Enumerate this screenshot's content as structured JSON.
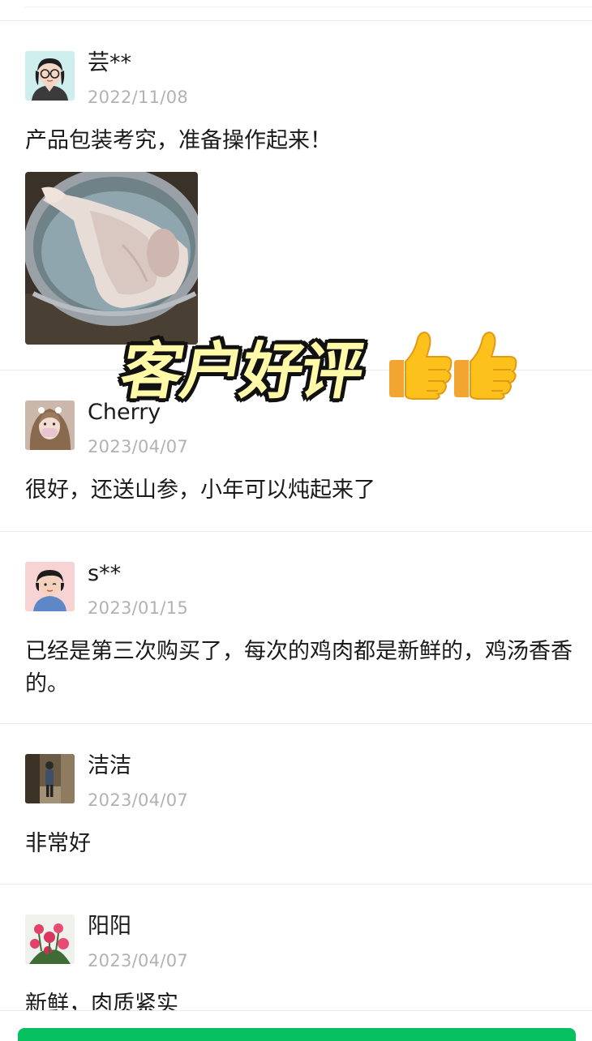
{
  "overlay": {
    "title": "客户好评"
  },
  "reviews": [
    {
      "name": "芸**",
      "date": "2022/11/08",
      "text": "产品包装考究，准备操作起来！",
      "avatar": "woman-glasses-avatar"
    },
    {
      "name": "Cherry",
      "date": "2023/04/07",
      "text": "很好，还送山参，小年可以炖起来了",
      "avatar": "girl-photo-avatar"
    },
    {
      "name": "s**",
      "date": "2023/01/15",
      "text": "已经是第三次购买了，每次的鸡肉都是新鲜的，鸡汤香香的。",
      "avatar": "cartoon-woman-avatar"
    },
    {
      "name": "洁洁",
      "date": "2023/04/07",
      "text": "非常好",
      "avatar": "street-photo-avatar"
    },
    {
      "name": "阳阳",
      "date": "2023/04/07",
      "text": "新鲜，肉质紧实",
      "avatar": "roses-avatar"
    }
  ],
  "colors": {
    "accent": "#07c160",
    "date": "#b2b2b2",
    "overlay_fill": "#fff9a8"
  }
}
